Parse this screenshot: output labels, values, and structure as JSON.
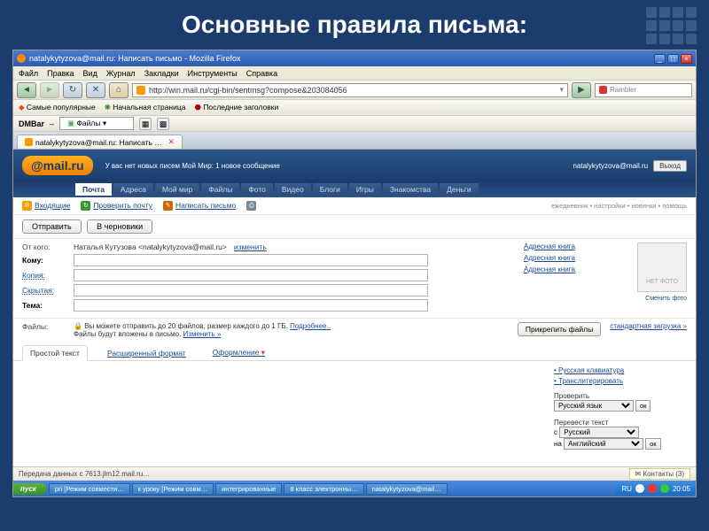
{
  "slide_title": "Основные правила письма:",
  "window": {
    "title": "natalykytyzova@mail.ru: Написать письмо - Mozilla Firefox"
  },
  "menu": [
    "Файл",
    "Правка",
    "Вид",
    "Журнал",
    "Закладки",
    "Инструменты",
    "Справка"
  ],
  "url": "http://win.mail.ru/cgi-bin/sentmsg?compose&203084056",
  "search_placeholder": "Rambler",
  "bookmarks": {
    "popular": "Самые популярные",
    "start": "Начальная страница",
    "latest": "Последние заголовки"
  },
  "dmbar": {
    "label": "DMBar",
    "files": "Файлы"
  },
  "tab": {
    "label": "natalykytyzova@mail.ru: Написать …"
  },
  "logo": "@mail.ru",
  "header": {
    "info": "У вас нет новых писем Мой Мир: 1 новое сообщение",
    "account": "natalykytyzova@mail.ru",
    "exit": "Выход"
  },
  "mtabs": [
    "Почта",
    "Адреса",
    "Мой мир",
    "Файлы",
    "Фото",
    "Видео",
    "Блоги",
    "Игры",
    "Знакомства",
    "Деньги"
  ],
  "mtab_active": 0,
  "linksrow": {
    "l1": "Входящие",
    "l2": "Проверить почту",
    "l3": "Написать письмо",
    "r": "ежедневник • настройки • новинки • помощь"
  },
  "buttons": {
    "send": "Отправить",
    "drafts": "В черновики"
  },
  "form": {
    "from_lbl": "От кого:",
    "from_val": "Наталья Кутузова <natalykytyzova@mail.ru>",
    "change": "изменить",
    "to_lbl": "Кому:",
    "cc_lbl": "Копия:",
    "bcc_lbl": "Скрытая:",
    "subj_lbl": "Тема:"
  },
  "address_book": "Адресная книга",
  "avatar_txt": "НЕТ ФОТО",
  "avatar_change": "Сменить фото",
  "files": {
    "lbl": "Файлы:",
    "txt1": "Вы можете отправить до 20 файлов, размер каждого до 1 ГБ. ",
    "more": "Подробнее..",
    "txt2": "Файлы будут вложены в письмо. ",
    "chg": "Изменить »",
    "attach": "Прикрепить файлы",
    "std": "стандартная загрузка »"
  },
  "fmt": {
    "plain": "Простой текст",
    "rich": "Расширенный формат",
    "style": "Оформление"
  },
  "side": {
    "kb": "Русская клавиатура",
    "trans": "Транслитерировать",
    "check": "Проверить",
    "lang": "Русский язык",
    "ok": "ок",
    "tr_lbl": "Перевести текст",
    "tr_from_lbl": "с",
    "tr_from": "Русский",
    "tr_to_lbl": "на",
    "tr_to": "Английский"
  },
  "status": {
    "text": "Передача данных с 7613.jlm12.mail.ru…",
    "popup": "Контакты (3)"
  },
  "taskbar": {
    "start": "пуск",
    "items": [
      "pri [Режим совмести…",
      "к уроку [Режим совм…",
      "интегрированные",
      "8 класс электронны…",
      "natalykytyzova@mail…"
    ],
    "lang": "RU",
    "time": "20:05"
  }
}
